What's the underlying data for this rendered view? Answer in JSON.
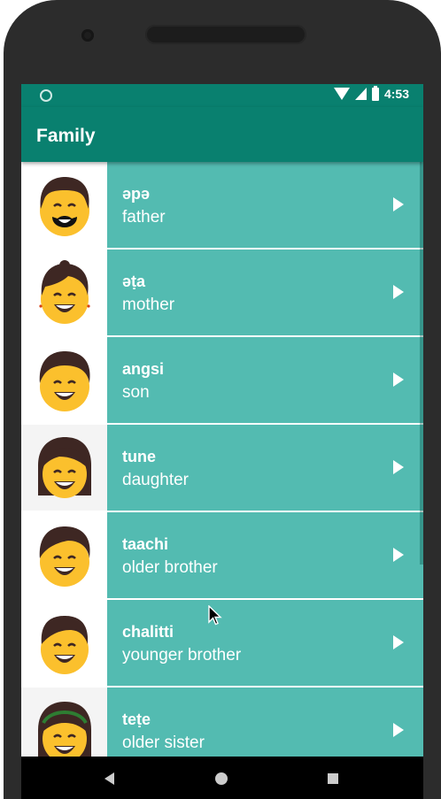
{
  "status_bar": {
    "time": "4:53"
  },
  "app_bar": {
    "title": "Family"
  },
  "colors": {
    "primary": "#09806f",
    "row_background": "#53bbb1",
    "text": "#ffffff"
  },
  "list": [
    {
      "word": "əpə",
      "translation": "father",
      "icon": "father-face-icon"
    },
    {
      "word": "əṭa",
      "translation": "mother",
      "icon": "mother-face-icon"
    },
    {
      "word": "angsi",
      "translation": "son",
      "icon": "son-face-icon"
    },
    {
      "word": "tune",
      "translation": "daughter",
      "icon": "daughter-face-icon"
    },
    {
      "word": "taachi",
      "translation": "older brother",
      "icon": "older-brother-face-icon"
    },
    {
      "word": "chalitti",
      "translation": "younger brother",
      "icon": "younger-brother-face-icon"
    },
    {
      "word": "teṭe",
      "translation": "older sister",
      "icon": "older-sister-face-icon"
    }
  ],
  "navigation": {
    "back_icon": "back-triangle-icon",
    "home_icon": "home-circle-icon",
    "recents_icon": "recents-square-icon"
  }
}
